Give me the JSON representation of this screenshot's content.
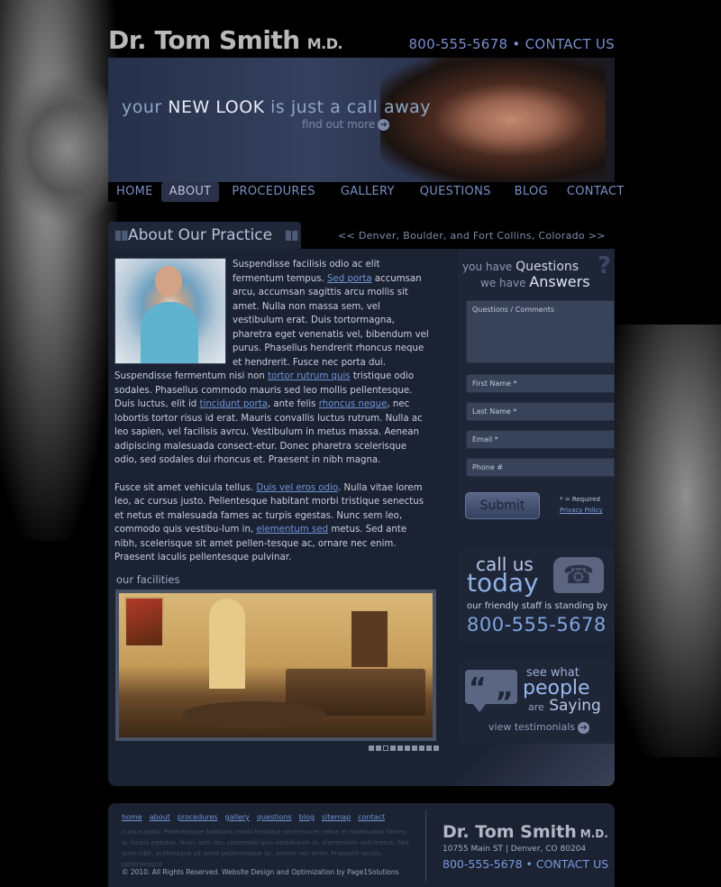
{
  "header": {
    "logo_name": "Dr. Tom Smith",
    "logo_suffix": "M.D.",
    "contact": "800-555-5678 • CONTACT US"
  },
  "banner": {
    "tag_pre": "your",
    "tag_bold": "NEW LOOK",
    "tag_post": "is just a call away",
    "more": "find out more"
  },
  "nav": {
    "items": [
      "HOME",
      "ABOUT",
      "PROCEDURES",
      "GALLERY",
      "QUESTIONS",
      "BLOG",
      "CONTACT"
    ],
    "active": "ABOUT"
  },
  "about": {
    "title": "About Our Practice",
    "location": "<< Denver, Boulder, and Fort Collins, Colorado >>",
    "p1_a": "Suspendisse facilisis odio ac elit fermentum tempus. ",
    "p1_link1": "Sed porta",
    "p1_b": " accumsan arcu, accumsan sagittis arcu mollis sit amet. Nulla non massa sem, vel vestibulum erat. Duis tortormagna, pharetra eget venenatis vel, bibendum vel purus. Phasellus hendrerit rhoncus neque et hendrerit. Fusce nec porta dui. Suspendisse fermentum nisi non ",
    "p1_link2": "tortor rutrum quis",
    "p1_c": " tristique odio sodales. Phasellus commodo mauris sed leo mollis pellentesque. Duis luctus, elit id ",
    "p1_link3": "tincidunt porta",
    "p1_d": ", ante felis ",
    "p1_link4": "rhoncus neque",
    "p1_e": ", nec lobortis tortor risus id erat. Mauris convallis luctus rutrum. Nulla ac leo sapien, vel facilisis avrcu. Vestibulum in metus massa. Aenean adipiscing malesuada consect-etur. Donec pharetra scelerisque odio, sed sodales dui rhoncus et. Praesent in nibh magna.",
    "p2_a": "Fusce sit amet vehicula tellus. ",
    "p2_link1": "Duis vel eros odio",
    "p2_b": ". Nulla vitae lorem leo, ac cursus justo. Pellentesque habitant morbi tristique senectus et netus et malesuada fames ac turpis egestas. Nunc sem leo, commodo quis vestibu-lum in, ",
    "p2_link2": "elementum sed",
    "p2_c": " metus. Sed ante nibh, scelerisque sit amet pellen-tesque ac, ornare nec enim. Praesent iaculis pellentesque pulvinar.",
    "facilities": "our facilities"
  },
  "questions": {
    "line1_pre": "you have",
    "line1_bold": "Questions",
    "line2_pre": "we have",
    "line2_bold": "Answers",
    "comments_placeholder": "Questions / Comments",
    "first_name": "First Name *",
    "last_name": "Last Name *",
    "email": "Email *",
    "phone": "Phone #",
    "submit": "Submit",
    "required": "* = Required",
    "privacy": "Privacy Policy"
  },
  "call": {
    "line1": "call us",
    "line2": "today",
    "sub": "our friendly staff is standing by",
    "phone": "800-555-5678"
  },
  "testimonials": {
    "line1": "see what",
    "line2": "people",
    "line3_pre": "are",
    "line3": "Saying",
    "link": "view testimonials"
  },
  "footer": {
    "links": [
      "home",
      "about",
      "procedures",
      "gallery",
      "questions",
      "blog",
      "sitemap",
      "contact"
    ],
    "lorem": "cursus justo. Pellentesque habitant morbi tristique senectus et netus et malesuada fames ac turpis egestas. Nunc sem leo, commodo quis vestibulum in, elementum sed metus. Sed ante nibh, scelerisque sit amet pellentesque ac, ornare nec enim. Praesent iaculis pellentesque",
    "copyright": "© 2010. All Rights Reserved.  Website Design and Optimization by Page1Solutions",
    "logo_name": "Dr. Tom Smith",
    "logo_suffix": "M.D.",
    "address": "10755  Main ST   |   Denver, CO 80204",
    "contact": "800-555-5678 • CONTACT US"
  }
}
